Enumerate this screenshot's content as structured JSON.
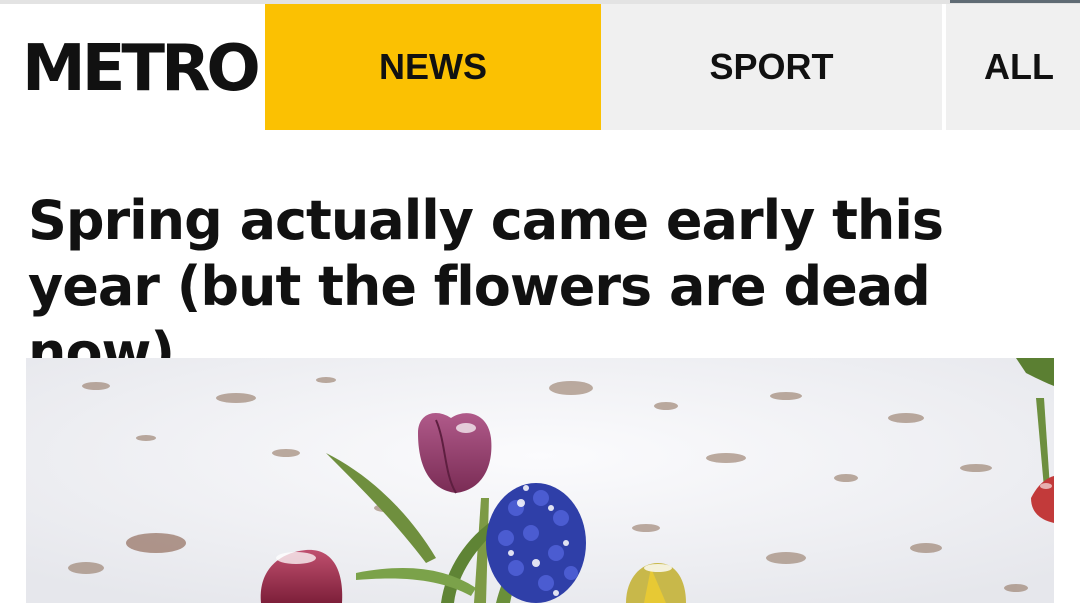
{
  "header": {
    "logo_text": "METRO",
    "nav": {
      "news_label": "NEWS",
      "sport_label": "SPORT",
      "all_label": "ALL"
    }
  },
  "article": {
    "headline": "Spring actually came early this year (but the flowers are dead now)",
    "hero_image": {
      "subject": "tulips-and-hyacinths-in-snow"
    }
  },
  "colors": {
    "accent": "#fbc102",
    "nav_inactive": "#f0f0f0",
    "text": "#111111"
  }
}
